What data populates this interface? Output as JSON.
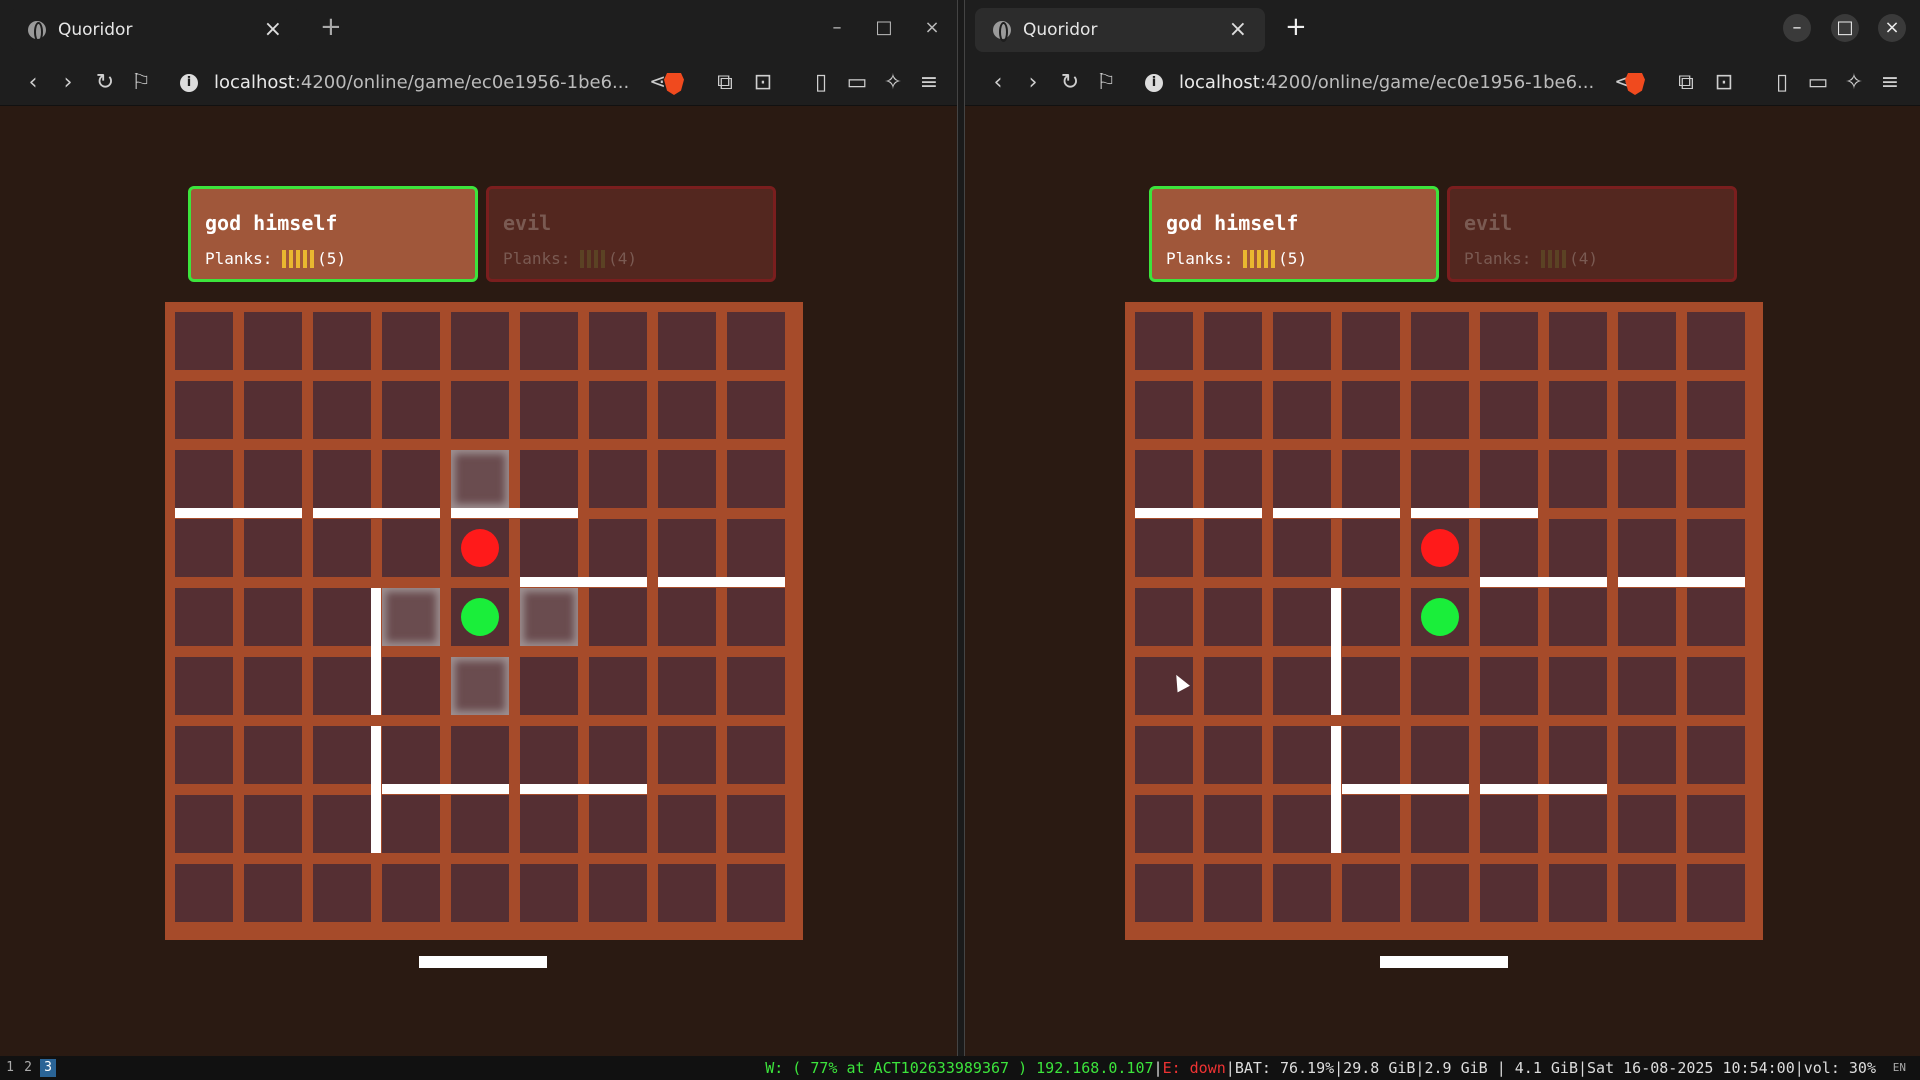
{
  "tab_title": "Quoridor",
  "url_host": "localhost",
  "url_rest": ":4200/online/game/ec0e1956-1be6...",
  "players": [
    {
      "name": "god himself",
      "planks_label": "Planks:",
      "planks": 5,
      "count_label": "(5)",
      "active": true
    },
    {
      "name": "evil",
      "planks_label": "Planks:",
      "planks": 4,
      "count_label": "(4)",
      "active": false
    }
  ],
  "pawns": {
    "red": {
      "row": 3,
      "col": 4
    },
    "green": {
      "row": 4,
      "col": 4
    }
  },
  "highlighted_cells": [
    [
      2,
      4
    ],
    [
      4,
      3
    ],
    [
      4,
      5
    ],
    [
      5,
      4
    ]
  ],
  "walls_h": [
    [
      2,
      0
    ],
    [
      2,
      2
    ],
    [
      2,
      4
    ],
    [
      3,
      5
    ],
    [
      3,
      7
    ],
    [
      6,
      3
    ],
    [
      6,
      5
    ]
  ],
  "walls_v": [
    [
      4,
      2
    ],
    [
      6,
      2
    ]
  ],
  "statusbar": {
    "workspaces": [
      "1",
      "2",
      "3"
    ],
    "active_workspace": "3",
    "wifi": "W: ( 77% at ACT102633989367 ) 192.168.0.107",
    "eth": "E: down",
    "rest": "BAT: 76.19%|29.8 GiB|2.9 GiB | 4.1 GiB|Sat 16-08-2025 10:54:00|vol: 30%",
    "lang": "EN"
  },
  "colors": {
    "active_border": "#3ce43c",
    "red_pawn": "#ff1a1a",
    "green_pawn": "#1aee3a",
    "board": "#a64b2a",
    "cell": "#552f33"
  }
}
